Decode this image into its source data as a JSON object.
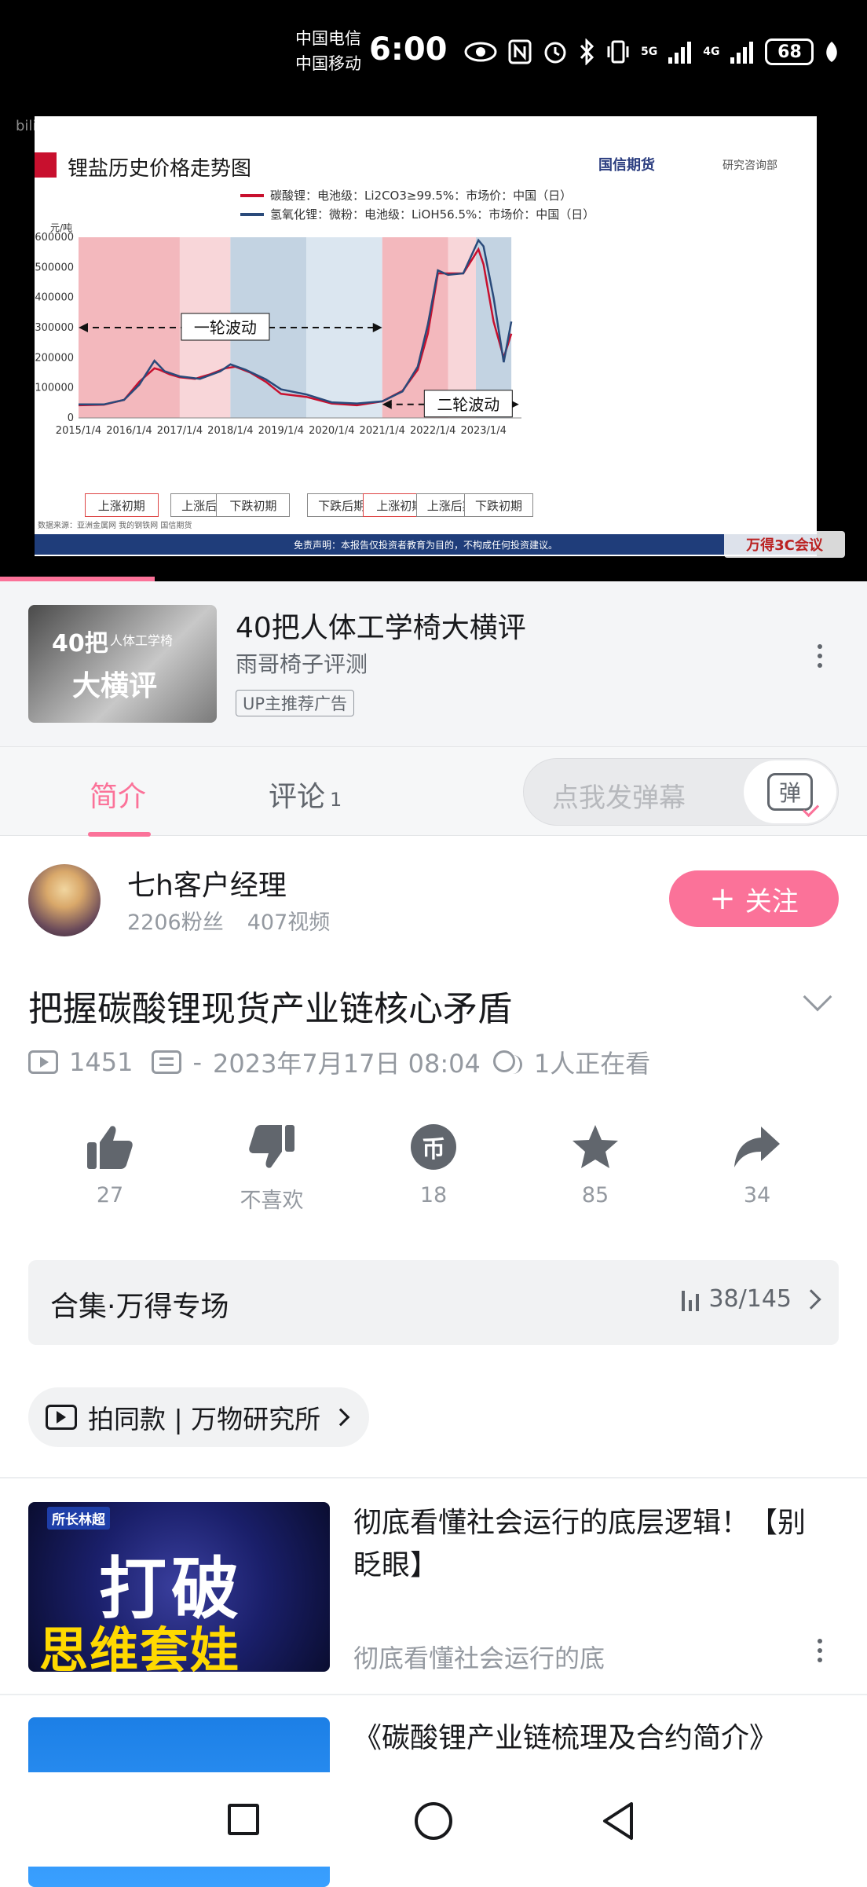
{
  "status_bar": {
    "carrier1": "中国电信",
    "carrier2": "中国移动",
    "time": "6:00",
    "battery": "68",
    "signal1": "5G",
    "signal2": "4G"
  },
  "video": {
    "watermark": "bilibili",
    "slide": {
      "title": "锂盐历史价格走势图",
      "logo": "国信期货",
      "logo_sub": "研究咨询部",
      "y_unit": "元/吨",
      "legend": [
        "碳酸锂：电池级：Li2CO3≥99.5%：市场价：中国（日）",
        "氢氧化锂：微粉：电池级：LiOH56.5%：市场价：中国（日）"
      ],
      "annotation_1": "一轮波动",
      "annotation_2": "二轮波动",
      "phases": [
        "上涨初期",
        "上涨后期",
        "下跌初期",
        "下跌后期",
        "上涨初期",
        "上涨后期",
        "下跌初期"
      ],
      "source": "数据来源：亚洲金属网 我的钢铁网 国信期货",
      "disclaimer": "免责声明：本报告仅投资者教育为目的，不构成任何投资建议。",
      "badge": "万得3C会议"
    },
    "progress_fraction": 0.178
  },
  "chart_data": {
    "type": "line",
    "title": "锂盐历史价格走势图",
    "ylabel": "元/吨",
    "ylim": [
      0,
      600000
    ],
    "y_ticks": [
      0,
      100000,
      200000,
      300000,
      400000,
      500000,
      600000
    ],
    "x_ticks": [
      "2015/1/4",
      "2016/1/4",
      "2017/1/4",
      "2018/1/4",
      "2019/1/4",
      "2020/1/4",
      "2021/1/4",
      "2022/1/4",
      "2023/1/4"
    ],
    "x_range": [
      2015.0,
      2023.75
    ],
    "series": [
      {
        "name": "碳酸锂：电池级：Li2CO3≥99.5%：市场价：中国（日）",
        "color": "#c8102e",
        "points": [
          [
            2015.0,
            42000
          ],
          [
            2015.5,
            44000
          ],
          [
            2015.9,
            60000
          ],
          [
            2016.2,
            120000
          ],
          [
            2016.5,
            165000
          ],
          [
            2016.6,
            160000
          ],
          [
            2016.8,
            145000
          ],
          [
            2017.0,
            135000
          ],
          [
            2017.3,
            130000
          ],
          [
            2017.6,
            145000
          ],
          [
            2017.9,
            165000
          ],
          [
            2018.1,
            170000
          ],
          [
            2018.4,
            150000
          ],
          [
            2018.7,
            120000
          ],
          [
            2019.0,
            80000
          ],
          [
            2019.5,
            70000
          ],
          [
            2020.0,
            48000
          ],
          [
            2020.5,
            42000
          ],
          [
            2021.0,
            55000
          ],
          [
            2021.4,
            90000
          ],
          [
            2021.7,
            160000
          ],
          [
            2021.9,
            280000
          ],
          [
            2022.1,
            480000
          ],
          [
            2022.3,
            480000
          ],
          [
            2022.6,
            480000
          ],
          [
            2022.9,
            560000
          ],
          [
            2023.0,
            510000
          ],
          [
            2023.2,
            320000
          ],
          [
            2023.4,
            200000
          ],
          [
            2023.55,
            280000
          ]
        ]
      },
      {
        "name": "氢氧化锂：微粉：电池级：LiOH56.5%：市场价：中国（日）",
        "color": "#2a4a7a",
        "points": [
          [
            2015.0,
            45000
          ],
          [
            2015.5,
            45000
          ],
          [
            2015.9,
            60000
          ],
          [
            2016.2,
            110000
          ],
          [
            2016.5,
            190000
          ],
          [
            2016.7,
            155000
          ],
          [
            2017.0,
            138000
          ],
          [
            2017.4,
            130000
          ],
          [
            2017.8,
            155000
          ],
          [
            2018.0,
            178000
          ],
          [
            2018.3,
            160000
          ],
          [
            2018.7,
            128000
          ],
          [
            2019.0,
            95000
          ],
          [
            2019.5,
            78000
          ],
          [
            2020.0,
            52000
          ],
          [
            2020.5,
            48000
          ],
          [
            2021.0,
            55000
          ],
          [
            2021.4,
            88000
          ],
          [
            2021.7,
            170000
          ],
          [
            2021.9,
            310000
          ],
          [
            2022.1,
            490000
          ],
          [
            2022.3,
            475000
          ],
          [
            2022.6,
            480000
          ],
          [
            2022.9,
            590000
          ],
          [
            2023.0,
            570000
          ],
          [
            2023.2,
            400000
          ],
          [
            2023.4,
            185000
          ],
          [
            2023.55,
            320000
          ]
        ]
      }
    ],
    "phase_bands": [
      {
        "from": 2015.0,
        "to": 2017.0,
        "color": "#f3b8bd"
      },
      {
        "from": 2017.0,
        "to": 2018.0,
        "color": "#f8d6d9"
      },
      {
        "from": 2018.0,
        "to": 2019.5,
        "color": "#c3d3e2"
      },
      {
        "from": 2019.5,
        "to": 2021.0,
        "color": "#dbe6f0"
      },
      {
        "from": 2021.0,
        "to": 2022.3,
        "color": "#f3b8bd"
      },
      {
        "from": 2022.3,
        "to": 2022.85,
        "color": "#f8d6d9"
      },
      {
        "from": 2022.85,
        "to": 2023.55,
        "color": "#c3d3e2"
      }
    ],
    "grid": false,
    "legend_position": "top"
  },
  "ad": {
    "thumb_line1": "40把",
    "thumb_line2": "人体工学椅",
    "thumb_line3": "大横评",
    "title": "40把人体工学椅大横评",
    "author": "雨哥椅子评测",
    "tag": "UP主推荐广告"
  },
  "tabs": {
    "intro": "简介",
    "comments": "评论",
    "comments_count": "1",
    "danmaku_placeholder": "点我发弹幕",
    "danmaku_icon_char": "弹"
  },
  "uploader": {
    "name": "七h客户经理",
    "fans": "2206粉丝",
    "videos": "407视频",
    "follow_label": "关注",
    "follow_plus": "+"
  },
  "video_info": {
    "title": "把握碳酸锂现货产业链核心矛盾",
    "views": "1451",
    "danmaku_count": "-",
    "date": "2023年7月17日 08:04",
    "watching": "1人正在看"
  },
  "actions": [
    {
      "icon": "thumbs-up-icon",
      "label": "27"
    },
    {
      "icon": "thumbs-down-icon",
      "label": "不喜欢"
    },
    {
      "icon": "coin-icon",
      "label": "18",
      "coin_char": "币"
    },
    {
      "icon": "star-icon",
      "label": "85"
    },
    {
      "icon": "share-icon",
      "label": "34"
    }
  ],
  "collection": {
    "title": "合集·万得专场",
    "progress": "38/145"
  },
  "same_style": {
    "label": "拍同款 | 万物研究所"
  },
  "recommendations": [
    {
      "thumb_tag": "所长林超",
      "thumb_big": "打破",
      "thumb_sub": "思维套娃",
      "title": "彻底看懂社会运行的底层逻辑！【别眨眼】",
      "subtitle": "彻底看懂社会运行的底"
    },
    {
      "title": "《碳酸锂产业链梳理及合约简介》"
    }
  ],
  "colors": {
    "accent": "#fb7299",
    "text_secondary": "#9499a0"
  }
}
